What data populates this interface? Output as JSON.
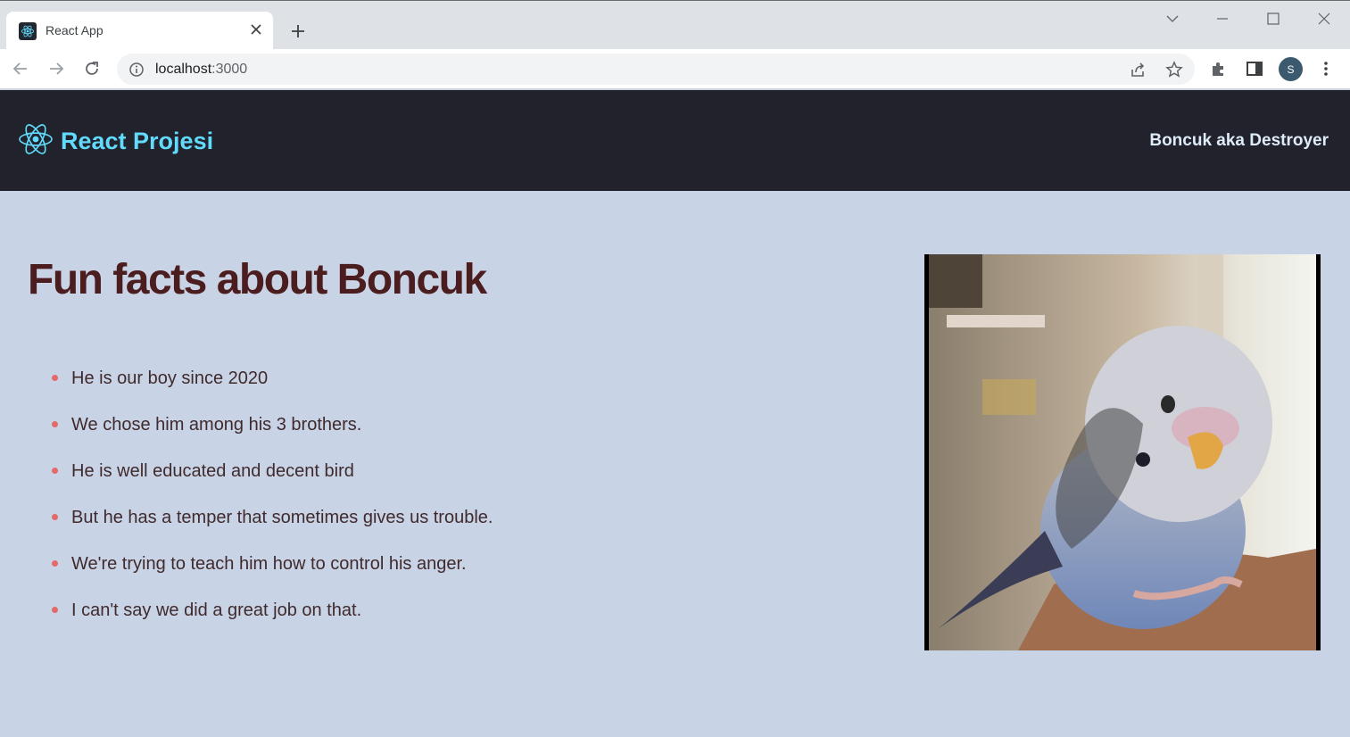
{
  "browser": {
    "tab_title": "React App",
    "url_host": "localhost",
    "url_port": ":3000",
    "avatar_letter": "S"
  },
  "navbar": {
    "brand": "React Projesi",
    "right_text": "Boncuk aka Destroyer"
  },
  "main": {
    "title": "Fun facts about Boncuk",
    "facts": [
      "He is our boy since 2020",
      "We chose him among his 3 brothers.",
      "He is well educated and decent bird",
      "But he has a temper that sometimes gives us trouble.",
      "We're trying to teach him how to control his anger.",
      "I can't say we did a great job on that."
    ]
  },
  "colors": {
    "navbar_bg": "#21222c",
    "brand": "#61dafb",
    "page_bg": "#c9d3e6",
    "title": "#4b1d1e",
    "bullet": "#e46a6a"
  },
  "icons": [
    "react-logo-icon",
    "close-icon",
    "plus-icon",
    "back-icon",
    "forward-icon",
    "reload-icon",
    "info-icon",
    "share-icon",
    "star-icon",
    "extensions-icon",
    "sidepanel-icon",
    "menu-icon"
  ]
}
